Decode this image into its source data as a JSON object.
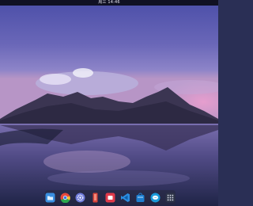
{
  "topbar": {
    "clock": "周三 14:46"
  },
  "dock": {
    "items": [
      {
        "name": "file-manager",
        "icon": "folder-icon",
        "color": "#3a8fe0"
      },
      {
        "name": "chrome",
        "icon": "chrome-icon",
        "color": "#e5483c"
      },
      {
        "name": "settings",
        "icon": "gear-icon",
        "color": "#6f7bd9"
      },
      {
        "name": "text-editor",
        "icon": "pencil-icon",
        "color": "#d9463c"
      },
      {
        "name": "app-store",
        "icon": "store-icon",
        "color": "#e03a4a"
      },
      {
        "name": "vscode",
        "icon": "code-icon",
        "color": "#2b8de0"
      },
      {
        "name": "software-center",
        "icon": "bag-icon",
        "color": "#1e7fd0"
      },
      {
        "name": "chat",
        "icon": "chat-bubble-icon",
        "color": "#1a9ad8"
      },
      {
        "name": "launcher",
        "icon": "grid-icon",
        "color": "#2d3348"
      }
    ]
  }
}
